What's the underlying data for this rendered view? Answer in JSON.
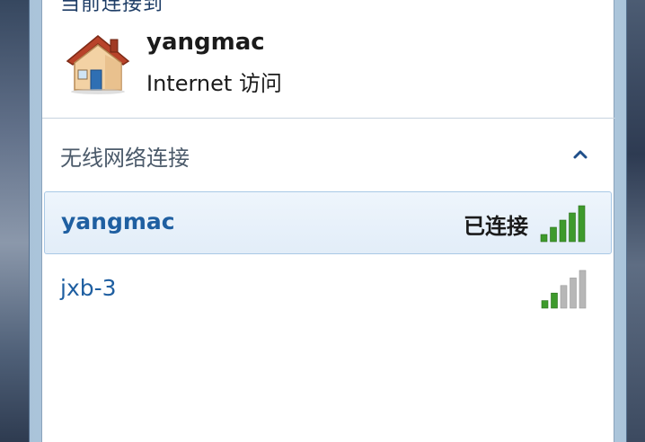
{
  "header": {
    "partial_title": "当前连接到"
  },
  "connected_network": {
    "name": "yangmac",
    "access": "Internet 访问",
    "icon": "home-network-icon"
  },
  "wireless_section": {
    "title": "无线网络连接",
    "toggle_icon": "chevron-up-icon"
  },
  "networks": [
    {
      "name": "yangmac",
      "status": "已连接",
      "signal_bars_lit": 5,
      "signal_bars_total": 5,
      "selected": true
    },
    {
      "name": "jxb-3",
      "status": "",
      "signal_bars_lit": 2,
      "signal_bars_total": 5,
      "selected": false
    }
  ],
  "colors": {
    "accent": "#1f5fa1",
    "signal_green": "#3e9a2c",
    "signal_gray": "#b7b7b7"
  }
}
